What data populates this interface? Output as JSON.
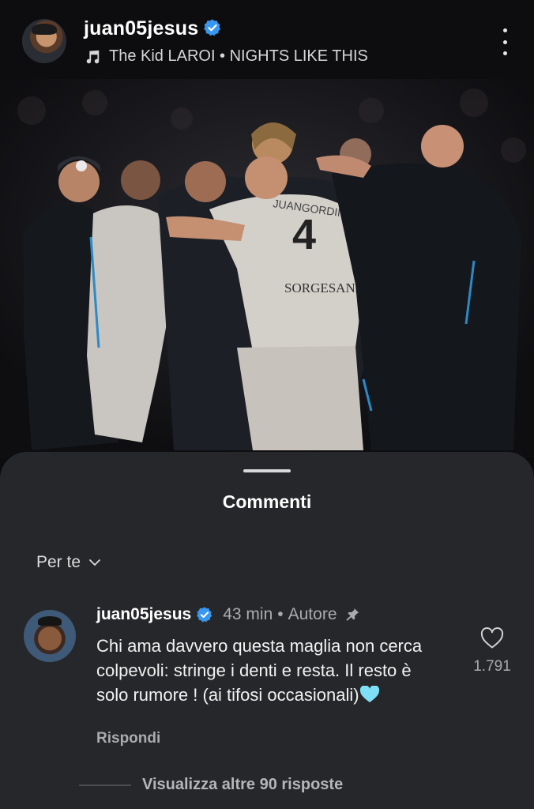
{
  "header": {
    "username": "juan05jesus",
    "music": "The Kid LAROI • NIGHTS LIKE THIS"
  },
  "post": {
    "jersey_number": "4",
    "jersey_name": "JUANGORDINE",
    "sponsor": "SORGESANA"
  },
  "comments_sheet": {
    "title": "Commenti",
    "sort_label": "Per te",
    "comment": {
      "username": "juan05jesus",
      "time": "43 min",
      "separator": "•",
      "badge": "Autore",
      "text": "Chi ama davvero questa maglia non cerca colpevoli: stringe i denti e resta. Il resto è solo rumore ! (ai tifosi occasionali)",
      "reply_label": "Rispondi",
      "like_count": "1.791"
    },
    "view_replies": "Visualizza altre 90 risposte"
  },
  "colors": {
    "sheet_bg": "#25272a",
    "verified_blue": "#3897f0",
    "emoji_heart": "#7fe0f5"
  },
  "icons": [
    "verified-icon",
    "music-note-icon",
    "more-options-icon",
    "chevron-down-icon",
    "pin-icon",
    "heart-outline-icon",
    "light-blue-heart-emoji"
  ]
}
